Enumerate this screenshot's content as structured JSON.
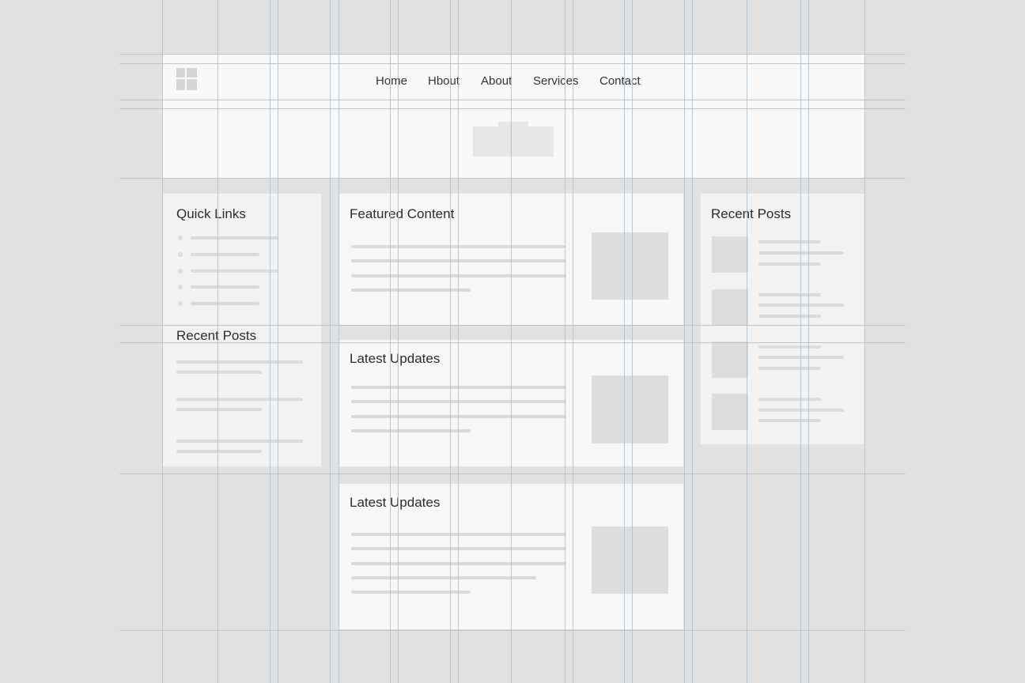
{
  "nav": {
    "logo_icon": "logo-grid-icon",
    "items": [
      {
        "label": "Home"
      },
      {
        "label": "Hbout"
      },
      {
        "label": "About"
      },
      {
        "label": "Services"
      },
      {
        "label": "Contact"
      }
    ]
  },
  "left_sidebar": {
    "quick_links_title": "Quick Links",
    "recent_posts_title": "Recent Posts"
  },
  "main": {
    "cards": [
      {
        "title": "Featured Content"
      },
      {
        "title": "Latest Updates"
      },
      {
        "title": "Latest Updates"
      }
    ]
  },
  "right_sidebar": {
    "recent_posts_title": "Recent Posts"
  },
  "colors": {
    "background": "#e1e1e1",
    "panel": "#f7f7f7",
    "placeholder": "#dadada",
    "guide_line": "#a9bfd4"
  }
}
